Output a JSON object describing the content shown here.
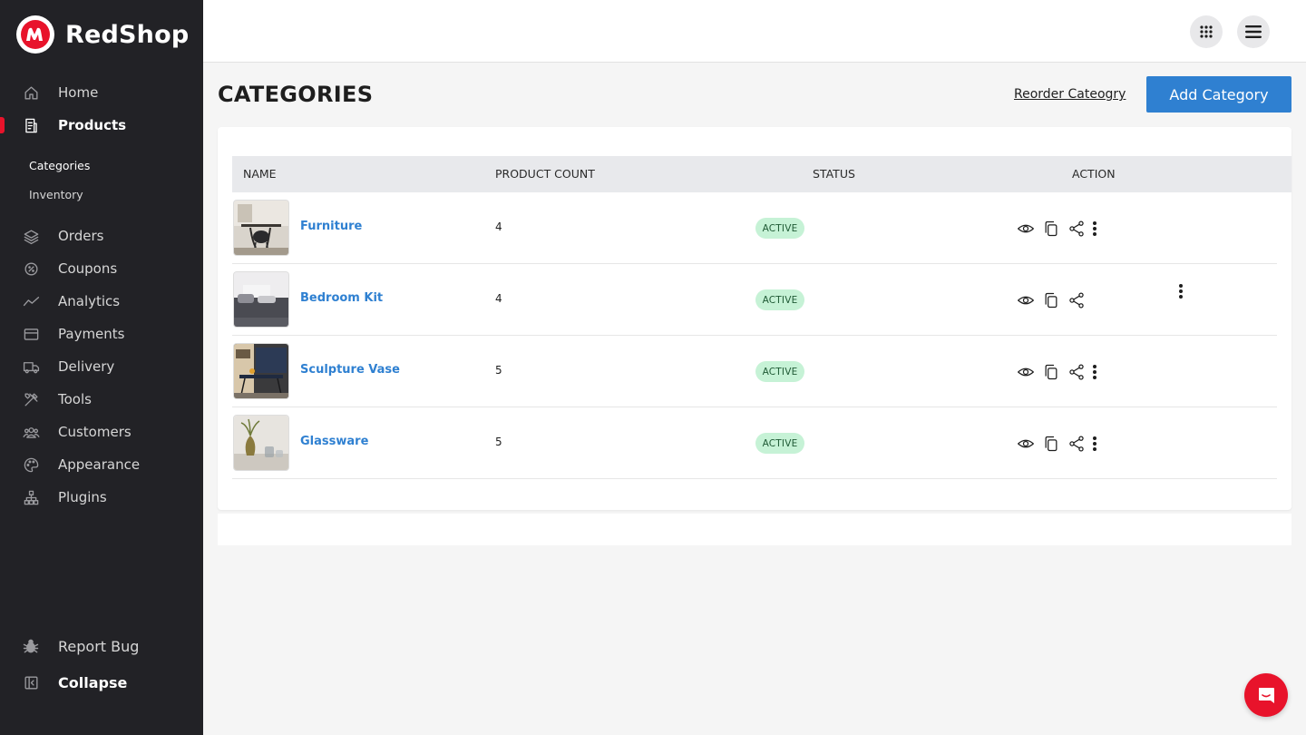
{
  "brand": {
    "name": "RedShop",
    "accent": "#e8132b"
  },
  "sidebar": {
    "items": [
      {
        "label": "Home",
        "icon": "home-icon"
      },
      {
        "label": "Products",
        "icon": "products-icon",
        "active": true,
        "children": [
          {
            "label": "Categories",
            "active": true
          },
          {
            "label": "Inventory"
          }
        ]
      },
      {
        "label": "Orders",
        "icon": "layers-icon"
      },
      {
        "label": "Coupons",
        "icon": "coupon-icon"
      },
      {
        "label": "Analytics",
        "icon": "analytics-icon"
      },
      {
        "label": "Payments",
        "icon": "card-icon"
      },
      {
        "label": "Delivery",
        "icon": "truck-icon"
      },
      {
        "label": "Tools",
        "icon": "tools-icon"
      },
      {
        "label": "Customers",
        "icon": "users-icon"
      },
      {
        "label": "Appearance",
        "icon": "palette-icon"
      },
      {
        "label": "Plugins",
        "icon": "sitemap-icon"
      }
    ],
    "bottom": {
      "report_bug": "Report Bug",
      "collapse": "Collapse"
    }
  },
  "header": {
    "title": "CATEGORIES",
    "reorder_label": "Reorder Cateogry",
    "add_label": "Add Category",
    "add_color": "#2f80d1"
  },
  "table": {
    "columns": [
      "NAME",
      "PRODUCT COUNT",
      "STATUS",
      "ACTION"
    ],
    "rows": [
      {
        "name": "Furniture",
        "count": "4",
        "status": "ACTIVE"
      },
      {
        "name": "Bedroom Kit",
        "count": "4",
        "status": "ACTIVE"
      },
      {
        "name": "Sculpture Vase",
        "count": "5",
        "status": "ACTIVE"
      },
      {
        "name": "Glassware",
        "count": "5",
        "status": "ACTIVE"
      }
    ]
  }
}
